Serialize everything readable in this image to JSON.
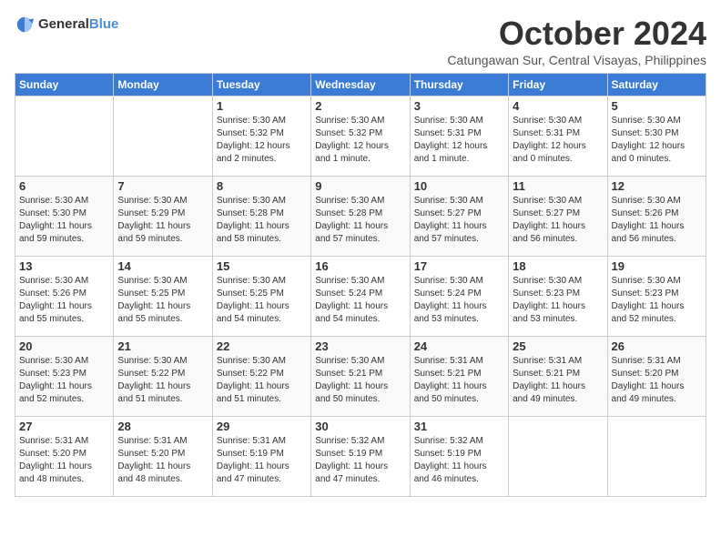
{
  "header": {
    "logo_general": "General",
    "logo_blue": "Blue",
    "month_title": "October 2024",
    "location": "Catungawan Sur, Central Visayas, Philippines"
  },
  "days_of_week": [
    "Sunday",
    "Monday",
    "Tuesday",
    "Wednesday",
    "Thursday",
    "Friday",
    "Saturday"
  ],
  "weeks": [
    [
      {
        "day": "",
        "info": ""
      },
      {
        "day": "",
        "info": ""
      },
      {
        "day": "1",
        "info": "Sunrise: 5:30 AM\nSunset: 5:32 PM\nDaylight: 12 hours\nand 2 minutes."
      },
      {
        "day": "2",
        "info": "Sunrise: 5:30 AM\nSunset: 5:32 PM\nDaylight: 12 hours\nand 1 minute."
      },
      {
        "day": "3",
        "info": "Sunrise: 5:30 AM\nSunset: 5:31 PM\nDaylight: 12 hours\nand 1 minute."
      },
      {
        "day": "4",
        "info": "Sunrise: 5:30 AM\nSunset: 5:31 PM\nDaylight: 12 hours\nand 0 minutes."
      },
      {
        "day": "5",
        "info": "Sunrise: 5:30 AM\nSunset: 5:30 PM\nDaylight: 12 hours\nand 0 minutes."
      }
    ],
    [
      {
        "day": "6",
        "info": "Sunrise: 5:30 AM\nSunset: 5:30 PM\nDaylight: 11 hours\nand 59 minutes."
      },
      {
        "day": "7",
        "info": "Sunrise: 5:30 AM\nSunset: 5:29 PM\nDaylight: 11 hours\nand 59 minutes."
      },
      {
        "day": "8",
        "info": "Sunrise: 5:30 AM\nSunset: 5:28 PM\nDaylight: 11 hours\nand 58 minutes."
      },
      {
        "day": "9",
        "info": "Sunrise: 5:30 AM\nSunset: 5:28 PM\nDaylight: 11 hours\nand 57 minutes."
      },
      {
        "day": "10",
        "info": "Sunrise: 5:30 AM\nSunset: 5:27 PM\nDaylight: 11 hours\nand 57 minutes."
      },
      {
        "day": "11",
        "info": "Sunrise: 5:30 AM\nSunset: 5:27 PM\nDaylight: 11 hours\nand 56 minutes."
      },
      {
        "day": "12",
        "info": "Sunrise: 5:30 AM\nSunset: 5:26 PM\nDaylight: 11 hours\nand 56 minutes."
      }
    ],
    [
      {
        "day": "13",
        "info": "Sunrise: 5:30 AM\nSunset: 5:26 PM\nDaylight: 11 hours\nand 55 minutes."
      },
      {
        "day": "14",
        "info": "Sunrise: 5:30 AM\nSunset: 5:25 PM\nDaylight: 11 hours\nand 55 minutes."
      },
      {
        "day": "15",
        "info": "Sunrise: 5:30 AM\nSunset: 5:25 PM\nDaylight: 11 hours\nand 54 minutes."
      },
      {
        "day": "16",
        "info": "Sunrise: 5:30 AM\nSunset: 5:24 PM\nDaylight: 11 hours\nand 54 minutes."
      },
      {
        "day": "17",
        "info": "Sunrise: 5:30 AM\nSunset: 5:24 PM\nDaylight: 11 hours\nand 53 minutes."
      },
      {
        "day": "18",
        "info": "Sunrise: 5:30 AM\nSunset: 5:23 PM\nDaylight: 11 hours\nand 53 minutes."
      },
      {
        "day": "19",
        "info": "Sunrise: 5:30 AM\nSunset: 5:23 PM\nDaylight: 11 hours\nand 52 minutes."
      }
    ],
    [
      {
        "day": "20",
        "info": "Sunrise: 5:30 AM\nSunset: 5:23 PM\nDaylight: 11 hours\nand 52 minutes."
      },
      {
        "day": "21",
        "info": "Sunrise: 5:30 AM\nSunset: 5:22 PM\nDaylight: 11 hours\nand 51 minutes."
      },
      {
        "day": "22",
        "info": "Sunrise: 5:30 AM\nSunset: 5:22 PM\nDaylight: 11 hours\nand 51 minutes."
      },
      {
        "day": "23",
        "info": "Sunrise: 5:30 AM\nSunset: 5:21 PM\nDaylight: 11 hours\nand 50 minutes."
      },
      {
        "day": "24",
        "info": "Sunrise: 5:31 AM\nSunset: 5:21 PM\nDaylight: 11 hours\nand 50 minutes."
      },
      {
        "day": "25",
        "info": "Sunrise: 5:31 AM\nSunset: 5:21 PM\nDaylight: 11 hours\nand 49 minutes."
      },
      {
        "day": "26",
        "info": "Sunrise: 5:31 AM\nSunset: 5:20 PM\nDaylight: 11 hours\nand 49 minutes."
      }
    ],
    [
      {
        "day": "27",
        "info": "Sunrise: 5:31 AM\nSunset: 5:20 PM\nDaylight: 11 hours\nand 48 minutes."
      },
      {
        "day": "28",
        "info": "Sunrise: 5:31 AM\nSunset: 5:20 PM\nDaylight: 11 hours\nand 48 minutes."
      },
      {
        "day": "29",
        "info": "Sunrise: 5:31 AM\nSunset: 5:19 PM\nDaylight: 11 hours\nand 47 minutes."
      },
      {
        "day": "30",
        "info": "Sunrise: 5:32 AM\nSunset: 5:19 PM\nDaylight: 11 hours\nand 47 minutes."
      },
      {
        "day": "31",
        "info": "Sunrise: 5:32 AM\nSunset: 5:19 PM\nDaylight: 11 hours\nand 46 minutes."
      },
      {
        "day": "",
        "info": ""
      },
      {
        "day": "",
        "info": ""
      }
    ]
  ]
}
